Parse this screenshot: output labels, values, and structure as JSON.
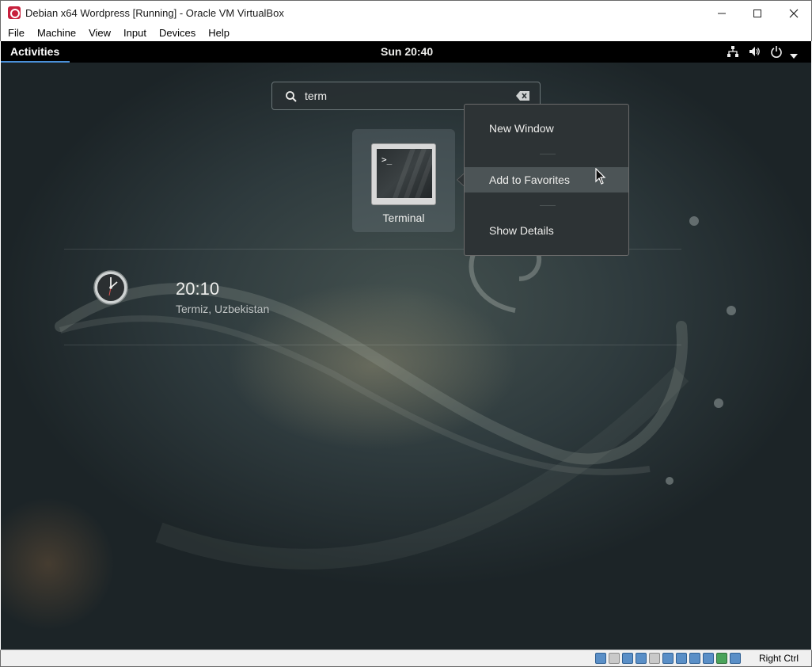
{
  "window": {
    "title": "Debian x64 Wordpress [Running] - Oracle VM VirtualBox",
    "icon": "virtualbox-icon",
    "controls": [
      "minimize-icon",
      "maximize-icon",
      "close-icon"
    ]
  },
  "menubar": {
    "items": [
      {
        "label": "File"
      },
      {
        "label": "Machine"
      },
      {
        "label": "View"
      },
      {
        "label": "Input"
      },
      {
        "label": "Devices"
      },
      {
        "label": "Help"
      }
    ]
  },
  "gnome": {
    "topbar": {
      "activities_label": "Activities",
      "clock": "Sun 20:40",
      "status_icons": [
        "network-icon",
        "volume-icon",
        "power-icon",
        "menu-caret-icon"
      ]
    },
    "search": {
      "value": "term",
      "icon": "search-icon",
      "clear_icon": "clear-text-icon"
    },
    "app_result": {
      "label": "Terminal",
      "prompt": ">_",
      "icon": "terminal-icon"
    },
    "context_menu": {
      "items": [
        {
          "label": "New Window"
        },
        {
          "label": "Add to Favorites",
          "hovered": true
        },
        {
          "label": "Show Details"
        }
      ]
    },
    "world_clock": {
      "time": "20:10",
      "place": "Termiz, Uzbekistan",
      "icon": "clock-icon"
    }
  },
  "statusbar": {
    "host_key": "Right Ctrl",
    "icons": [
      "hard-disk-icon",
      "optical-drive-icon",
      "audio-icon",
      "network-adapter-icon",
      "usb-icon",
      "shared-folders-icon",
      "display-icon",
      "video-capture-icon",
      "mouse-integration-icon",
      "cpu-icon",
      "keyboard-icon"
    ]
  },
  "colors": {
    "accent": "#4a90d9",
    "topbar_bg": "#000000",
    "menu_bg": "#2d3335",
    "menu_hover": "#4c5456"
  }
}
